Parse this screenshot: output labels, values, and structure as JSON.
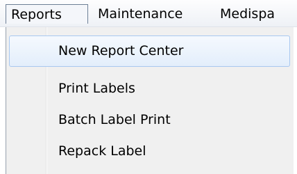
{
  "menubar": {
    "items": [
      {
        "label": "Reports",
        "active": true
      },
      {
        "label": "Maintenance"
      },
      {
        "label": "Medispa"
      }
    ]
  },
  "dropdown": {
    "items": [
      {
        "label": "New Report Center",
        "highlighted": true
      },
      {
        "label": "Print Labels"
      },
      {
        "label": "Batch Label Print"
      },
      {
        "label": "Repack Label"
      }
    ]
  },
  "colors": {
    "highlight_border": "#a8c8f0",
    "menu_background": "#f0f0f0",
    "active_menu_border": "#6d7f96"
  }
}
